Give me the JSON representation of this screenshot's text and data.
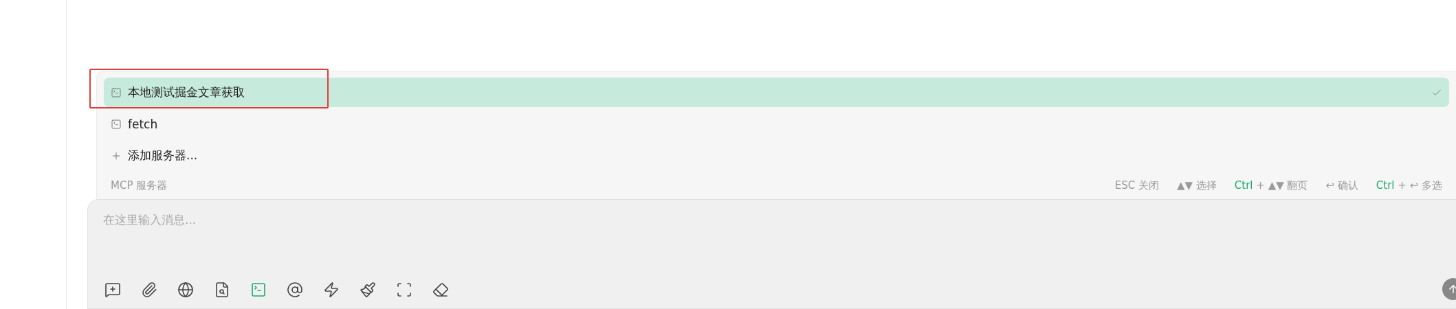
{
  "server_menu": {
    "items": [
      {
        "kind": "server",
        "label": "本地测试掘金文章获取",
        "selected": true
      },
      {
        "kind": "server",
        "label": "fetch",
        "selected": false
      },
      {
        "kind": "add",
        "label": "添加服务器...",
        "selected": false
      }
    ],
    "footer_title": "MCP 服务器",
    "hints": [
      [
        {
          "kind": "plain",
          "text": "ESC 关闭"
        }
      ],
      [
        {
          "kind": "plain",
          "text": "▲▼ 选择"
        }
      ],
      [
        {
          "kind": "accent",
          "text": "Ctrl"
        },
        {
          "kind": "plain",
          "text": " + ▲▼ 翻页"
        }
      ],
      [
        {
          "kind": "plain",
          "text": "↩ 确认"
        }
      ],
      [
        {
          "kind": "accent",
          "text": "Ctrl"
        },
        {
          "kind": "plain",
          "text": " + ↩ 多选"
        }
      ]
    ]
  },
  "composer": {
    "placeholder": "在这里输入消息...",
    "tools": [
      {
        "kind": "new-topic",
        "selected": false
      },
      {
        "kind": "attach",
        "selected": false
      },
      {
        "kind": "web",
        "selected": false
      },
      {
        "kind": "file-search",
        "selected": false
      },
      {
        "kind": "terminal",
        "selected": true
      },
      {
        "kind": "mention",
        "selected": false
      },
      {
        "kind": "flash",
        "selected": false
      },
      {
        "kind": "brush",
        "selected": false
      },
      {
        "kind": "fullscreen",
        "selected": false
      },
      {
        "kind": "eraser",
        "selected": false
      }
    ]
  },
  "annotation": {
    "kind": "frame"
  }
}
